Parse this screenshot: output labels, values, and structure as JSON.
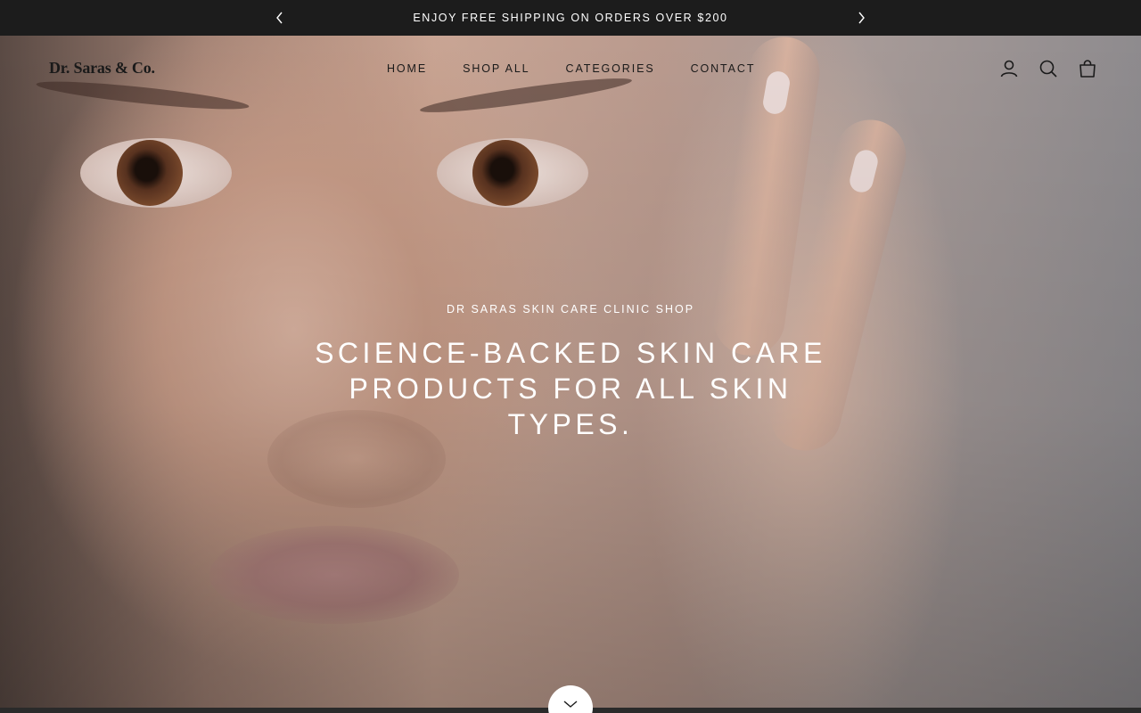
{
  "announcement": {
    "text": "ENJOY FREE SHIPPING ON ORDERS OVER $200",
    "prev_icon": "chevron-left-icon",
    "next_icon": "chevron-right-icon"
  },
  "header": {
    "logo": "Dr. Saras & Co.",
    "nav": [
      {
        "label": "HOME"
      },
      {
        "label": "SHOP ALL"
      },
      {
        "label": "CATEGORIES"
      },
      {
        "label": "CONTACT"
      }
    ],
    "icons": [
      "account-icon",
      "search-icon",
      "cart-icon"
    ]
  },
  "hero": {
    "subheading": "DR SARAS SKIN CARE CLINIC SHOP",
    "title": "SCIENCE-BACKED SKIN CARE PRODUCTS FOR ALL SKIN TYPES.",
    "scroll_icon": "chevron-down-icon"
  },
  "colors": {
    "announcement_bg": "#1c1c1c",
    "text_light": "#ffffff",
    "text_dark": "#1a1a1a"
  }
}
